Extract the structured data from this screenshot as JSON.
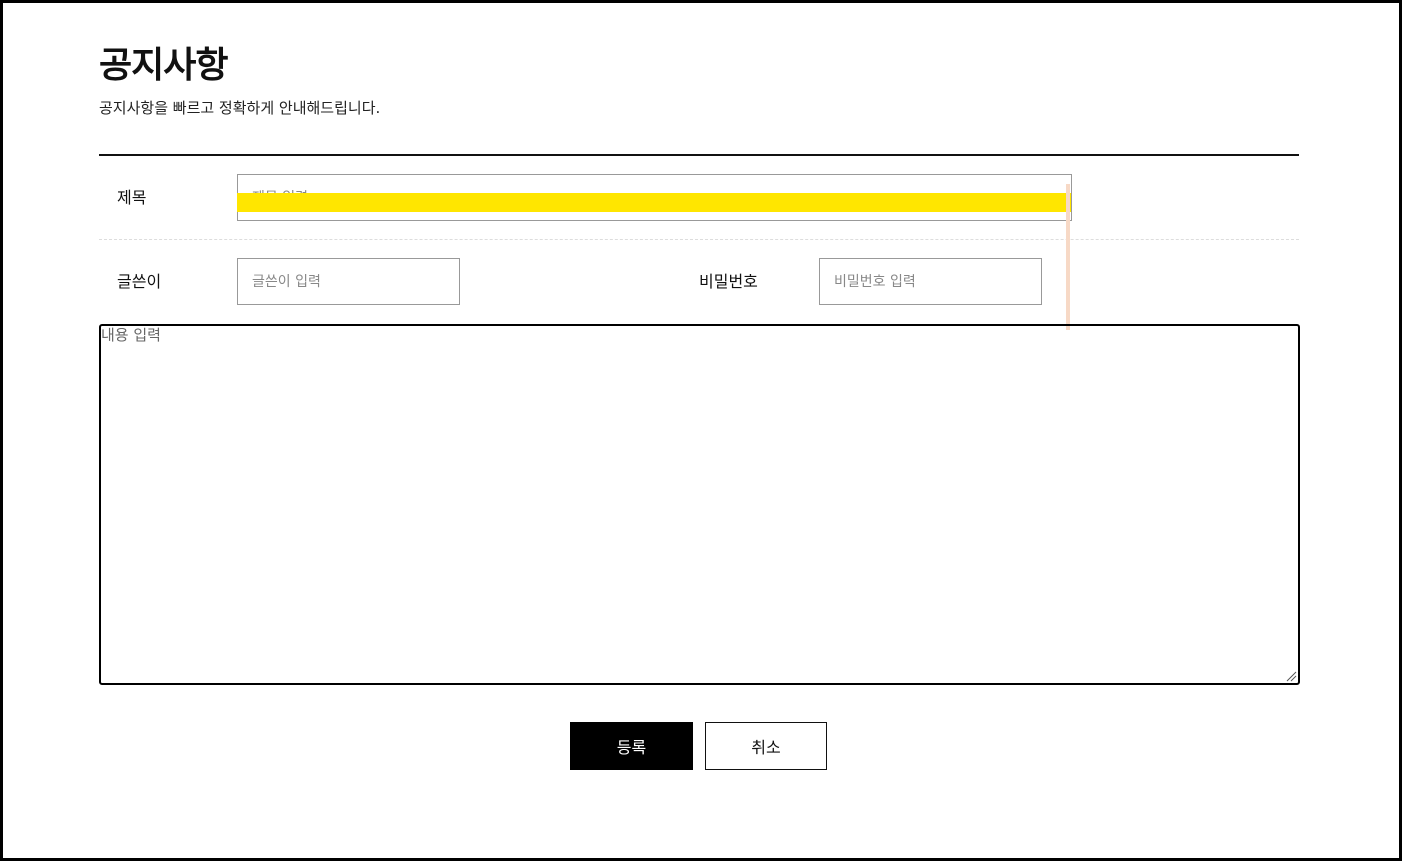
{
  "page": {
    "title": "공지사항",
    "subtitle": "공지사항을 빠르고 정확하게 안내해드립니다."
  },
  "form": {
    "title_label": "제목",
    "title_placeholder": "제목 입력",
    "title_value": "",
    "writer_label": "글쓴이",
    "writer_placeholder": "글쓴이 입력",
    "writer_value": "",
    "password_label": "비밀번호",
    "password_placeholder": "비밀번호 입력",
    "password_value": "",
    "content_placeholder": "내용 입력",
    "content_value": ""
  },
  "buttons": {
    "submit_label": "등록",
    "cancel_label": "취소"
  },
  "colors": {
    "highlight": "#ffe600",
    "accent_line": "#f7d9c6",
    "primary_button_bg": "#000000"
  }
}
